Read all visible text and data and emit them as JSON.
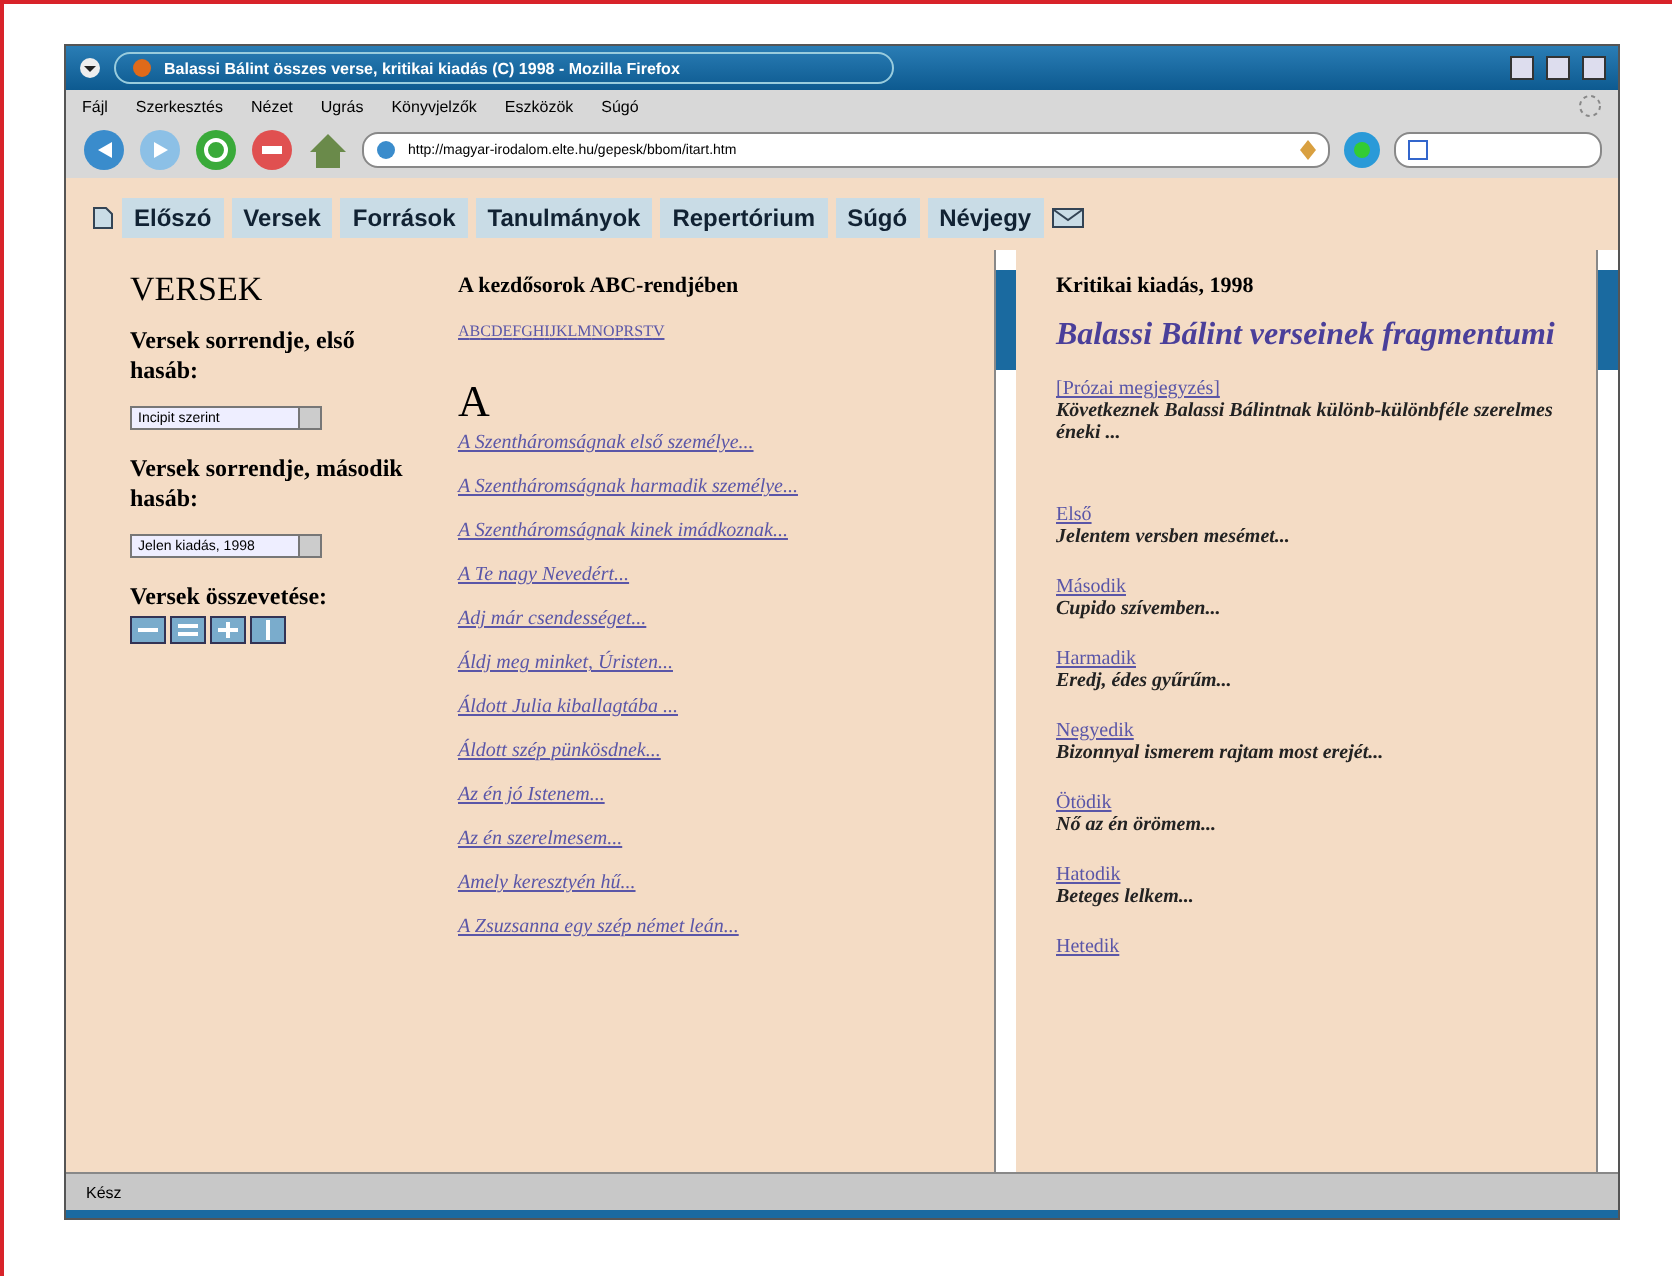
{
  "window": {
    "title": "Balassi Bálint összes verse, kritikai kiadás (C) 1998 - Mozilla Firefox"
  },
  "menu": [
    "Fájl",
    "Szerkesztés",
    "Nézet",
    "Ugrás",
    "Könyvjelzők",
    "Eszközök",
    "Súgó"
  ],
  "toolbar": {
    "url": "http://magyar-irodalom.elte.hu/gepesk/bbom/itart.htm"
  },
  "nav": [
    "Előszó",
    "Versek",
    "Források",
    "Tanulmányok",
    "Repertórium",
    "Súgó",
    "Névjegy"
  ],
  "left": {
    "heading": "VERSEK",
    "sort1_label": "Versek sorrendje, első hasáb:",
    "sort1_value": "Incipit szerint",
    "sort2_label": "Versek sorrendje, második hasáb:",
    "sort2_value": "Jelen kiadás, 1998",
    "compare_label": "Versek összevetése:"
  },
  "middle": {
    "heading": "A kezdősorok ABC-rendjében",
    "letters": [
      "A",
      "B",
      "C",
      "D",
      "E",
      "F",
      "G",
      "H",
      "I",
      "J",
      "K",
      "L",
      "M",
      "N",
      "O",
      "P",
      "R",
      "S",
      "T",
      "V"
    ],
    "section": "A",
    "poems": [
      "A Szentháromságnak első személye...",
      "A Szentháromságnak harmadik személye...",
      "A Szentháromságnak  kinek imádkoznak...",
      "A Te nagy Nevedért...",
      "Adj már csendességet...",
      "Áldj meg minket, Úristen...",
      "Áldott Julia kiballagtába ...",
      "Áldott szép pünkösdnek...",
      "Az én jó Istenem...",
      "Az én szerelmesem...",
      "Amely keresztyén hű...",
      "A Zsuzsanna egy szép német leán..."
    ]
  },
  "right": {
    "edition": "Kritikai kiadás, 1998",
    "title": "Balassi Bálint verseinek fragmentumi",
    "entries": [
      {
        "link": "[Prózai megjegyzés]",
        "text": "Következnek Balassi Bálintnak különb-különbféle szerelmes éneki ..."
      },
      {
        "link": "Első",
        "text": "Jelentem versben mesémet..."
      },
      {
        "link": "Második",
        "text": "Cupido szívemben..."
      },
      {
        "link": "Harmadik",
        "text": "Eredj, édes gyűrűm..."
      },
      {
        "link": "Negyedik",
        "text": "Bizonnyal ismerem rajtam most erejét..."
      },
      {
        "link": "Ötödik",
        "text": "Nő az én örömem..."
      },
      {
        "link": "Hatodik",
        "text": "Beteges lelkem..."
      },
      {
        "link": "Hetedik"
      }
    ]
  },
  "status_bar": "Kész"
}
